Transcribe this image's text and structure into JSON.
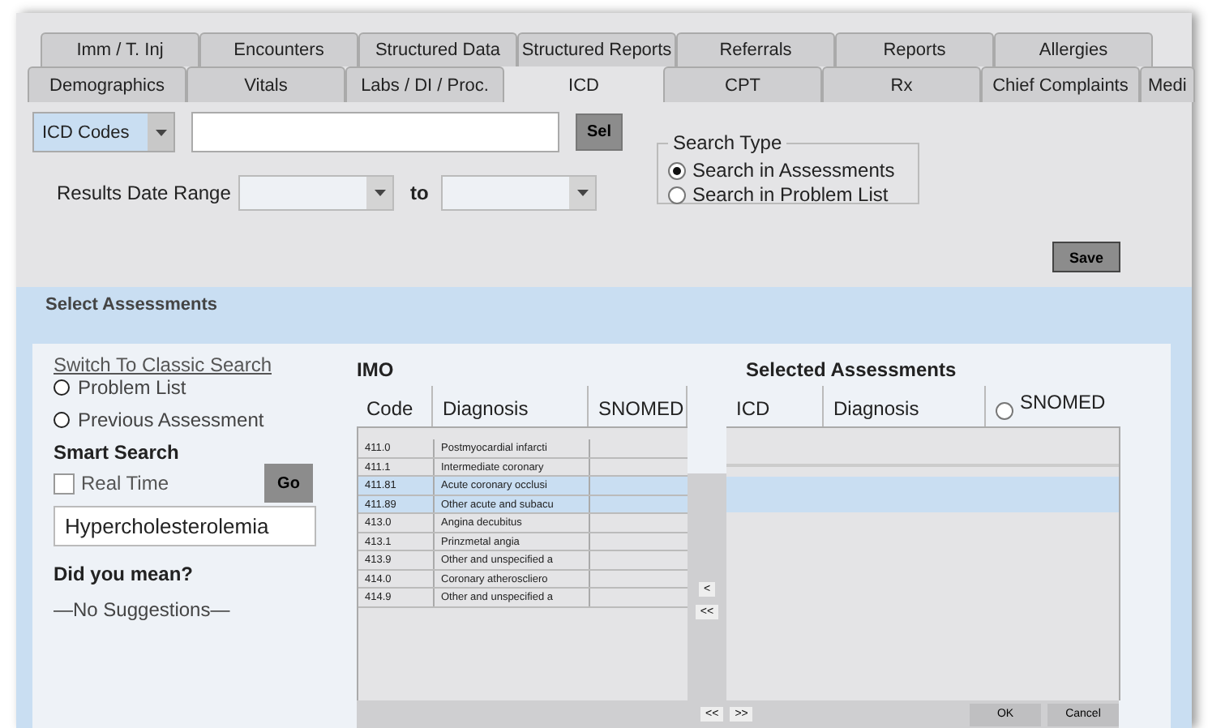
{
  "tabs_row_1": [
    {
      "label": "Imm / T. Inj",
      "selected": false
    },
    {
      "label": "Encounters",
      "selected": false
    },
    {
      "label": "Structured Data",
      "selected": false
    },
    {
      "label": "Structured Reports",
      "selected": false
    },
    {
      "label": "Referrals",
      "selected": false
    },
    {
      "label": "Reports",
      "selected": false
    },
    {
      "label": "Allergies",
      "selected": false
    }
  ],
  "tabs_row_2": [
    {
      "label": "Demographics",
      "selected": false
    },
    {
      "label": "Vitals",
      "selected": false
    },
    {
      "label": "Labs / DI / Proc.",
      "selected": false
    },
    {
      "label": "ICD",
      "selected": true
    },
    {
      "label": "CPT",
      "selected": false
    },
    {
      "label": "Rx",
      "selected": false
    },
    {
      "label": "Chief Complaints",
      "selected": false
    },
    {
      "label": "Medi",
      "selected": false
    }
  ],
  "code_type": {
    "value": "ICD Codes"
  },
  "sel_button": "Sel",
  "date_range": {
    "label": "Results Date Range",
    "to": "to"
  },
  "search_type": {
    "legend": "Search Type",
    "options": [
      {
        "label": "Search in Assessments",
        "selected": true
      },
      {
        "label": "Search in Problem List",
        "selected": false
      }
    ]
  },
  "save_button": "Save",
  "section_title": "Select Assessments",
  "search_panel": {
    "classic_link": "Switch To Classic Search",
    "sources": [
      {
        "label": "Problem List",
        "selected": false
      },
      {
        "label": "Previous Assessment",
        "selected": false
      }
    ],
    "smart_search_title": "Smart Search",
    "real_time": {
      "label": "Real Time",
      "checked": false
    },
    "go_button": "Go",
    "query": "Hypercholesterolemia",
    "did_you_mean": "Did you mean?",
    "suggestions": "—No Suggestions—"
  },
  "imo": {
    "title": "IMO",
    "columns": [
      "Code",
      "Diagnosis",
      "SNOMED"
    ],
    "rows": [
      {
        "code": "411.0",
        "diagnosis": "Postmyocardial infarcti",
        "selected": false
      },
      {
        "code": "411.1",
        "diagnosis": "Intermediate coronary",
        "selected": false
      },
      {
        "code": "411.81",
        "diagnosis": "Acute coronary occlusi",
        "selected": true
      },
      {
        "code": "411.89",
        "diagnosis": "Other acute and subacu",
        "selected": true
      },
      {
        "code": "413.0",
        "diagnosis": "Angina decubitus",
        "selected": false
      },
      {
        "code": "413.1",
        "diagnosis": "Prinzmetal angia",
        "selected": false
      },
      {
        "code": "413.9",
        "diagnosis": "Other and unspecified a",
        "selected": false
      },
      {
        "code": "414.0",
        "diagnosis": "Coronary atheroscliero",
        "selected": false
      },
      {
        "code": "414.9",
        "diagnosis": "Other and unspecified a",
        "selected": false
      }
    ],
    "pager": [
      "<<",
      ">>"
    ]
  },
  "transfer_buttons": [
    "<",
    "<<"
  ],
  "selected_assessments": {
    "title": "Selected Assessments",
    "columns": [
      "ICD",
      "Diagnosis",
      "SNOMED"
    ],
    "buttons": [
      "OK",
      "Cancel"
    ]
  }
}
